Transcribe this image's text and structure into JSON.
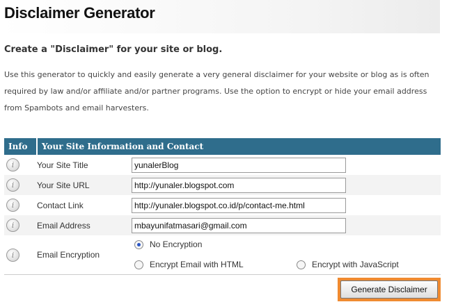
{
  "page": {
    "title": "Disclaimer Generator",
    "subtitle": "Create a \"Disclaimer\" for your site or blog.",
    "intro": "Use this generator to quickly and easily generate a very general disclaimer for your website or blog as is often required by law and/or affiliate and/or partner programs. Use the option to encrypt or hide your email address from Spambots and email harvesters."
  },
  "table": {
    "header_info": "Info",
    "header_main": "Your Site Information and Contact"
  },
  "fields": [
    {
      "label": "Your Site Title",
      "value": "yunalerBlog"
    },
    {
      "label": "Your Site URL",
      "value": "http://yunaler.blogspot.com"
    },
    {
      "label": "Contact Link",
      "value": "http://yunaler.blogspot.co.id/p/contact-me.html"
    },
    {
      "label": "Email Address",
      "value": "mbayunifatmasari@gmail.com"
    }
  ],
  "encryption": {
    "label": "Email Encryption",
    "options": [
      {
        "label": "No Encryption",
        "checked": true
      },
      {
        "label": "Encrypt Email with HTML",
        "checked": false
      },
      {
        "label": "Encrypt with JavaScript",
        "checked": false
      }
    ]
  },
  "icons": {
    "info": "info-icon",
    "info_glyph": "i"
  },
  "submit": {
    "label": "Generate Disclaimer"
  },
  "colors": {
    "table_header": "#2f6d8c",
    "button_highlight": "#f08a30"
  }
}
